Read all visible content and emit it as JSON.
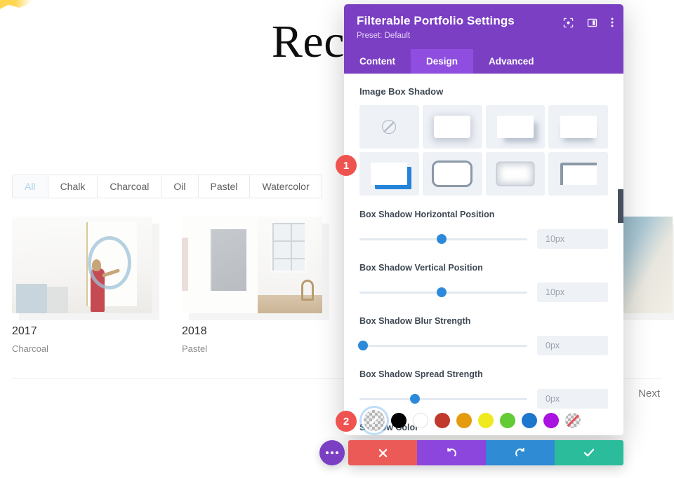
{
  "page": {
    "title": "Recent",
    "brush_icon": "yellow-brush-stroke",
    "filters": [
      {
        "label": "All",
        "active": true
      },
      {
        "label": "Chalk",
        "active": false
      },
      {
        "label": "Charcoal",
        "active": false
      },
      {
        "label": "Oil",
        "active": false
      },
      {
        "label": "Pastel",
        "active": false
      },
      {
        "label": "Watercolor",
        "active": false
      }
    ],
    "portfolio": [
      {
        "year": "2017",
        "category": "Charcoal"
      },
      {
        "year": "2018",
        "category": "Pastel"
      }
    ],
    "pagination": {
      "next": "Next"
    }
  },
  "modal": {
    "title": "Filterable Portfolio Settings",
    "preset": "Preset: Default",
    "header_icons": [
      {
        "name": "focus-icon"
      },
      {
        "name": "layout-panel-icon"
      },
      {
        "name": "kebab-menu-icon"
      }
    ],
    "tabs": [
      {
        "label": "Content",
        "active": false
      },
      {
        "label": "Design",
        "active": true
      },
      {
        "label": "Advanced",
        "active": false
      }
    ],
    "box_shadow": {
      "section_label": "Image Box Shadow",
      "presets": [
        {
          "name": "shadow-none",
          "selected": false
        },
        {
          "name": "shadow-soft-all",
          "selected": false
        },
        {
          "name": "shadow-offset-bottom-right",
          "selected": false
        },
        {
          "name": "shadow-bottom-only",
          "selected": false
        },
        {
          "name": "shadow-solid-offset",
          "selected": true
        },
        {
          "name": "shadow-outline",
          "selected": false
        },
        {
          "name": "shadow-inset",
          "selected": false
        },
        {
          "name": "shadow-corner-top-left",
          "selected": false
        }
      ]
    },
    "sliders": [
      {
        "label": "Box Shadow Horizontal Position",
        "value": "10px",
        "percent": 49
      },
      {
        "label": "Box Shadow Vertical Position",
        "value": "10px",
        "percent": 49
      },
      {
        "label": "Box Shadow Blur Strength",
        "value": "0px",
        "percent": 2
      },
      {
        "label": "Box Shadow Spread Strength",
        "value": "0px",
        "percent": 33
      }
    ],
    "shadow_color": {
      "label": "Shadow Color",
      "swatches": [
        {
          "name": "swatch-transparent-picker",
          "color": "transparent",
          "selected": true
        },
        {
          "name": "swatch-black",
          "color": "#000000",
          "selected": false
        },
        {
          "name": "swatch-white",
          "color": "#ffffff",
          "selected": false
        },
        {
          "name": "swatch-red",
          "color": "#c0392b",
          "selected": false
        },
        {
          "name": "swatch-orange",
          "color": "#e49b0f",
          "selected": false
        },
        {
          "name": "swatch-yellow",
          "color": "#eeea1e",
          "selected": false
        },
        {
          "name": "swatch-green",
          "color": "#63cb34",
          "selected": false
        },
        {
          "name": "swatch-blue",
          "color": "#1d77cc",
          "selected": false
        },
        {
          "name": "swatch-purple",
          "color": "#a912e0",
          "selected": false
        },
        {
          "name": "swatch-none",
          "color": "none",
          "selected": false
        }
      ]
    },
    "callouts": [
      {
        "number": "1",
        "color": "#ef5350"
      },
      {
        "number": "2",
        "color": "#ef5350"
      }
    ],
    "actions": [
      {
        "name": "more-options-button",
        "icon": "ellipsis-icon",
        "color": "#7b3fc4"
      },
      {
        "name": "discard-button",
        "icon": "close-icon",
        "color": "#ec5a57"
      },
      {
        "name": "undo-button",
        "icon": "undo-icon",
        "color": "#8c45dd"
      },
      {
        "name": "redo-button",
        "icon": "redo-icon",
        "color": "#2e8bd4"
      },
      {
        "name": "save-button",
        "icon": "check-icon",
        "color": "#2bbd9b"
      }
    ]
  }
}
